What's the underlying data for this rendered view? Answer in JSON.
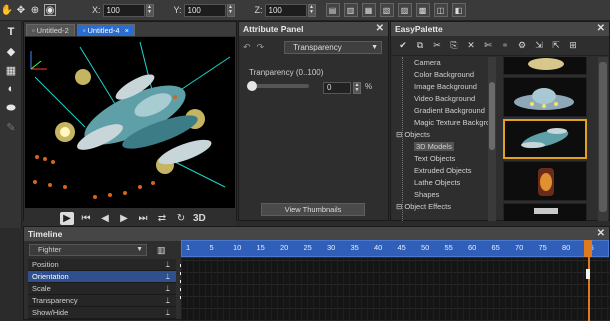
{
  "toolbar": {
    "x_label": "X:",
    "x_value": "100",
    "y_label": "Y:",
    "y_value": "100",
    "z_label": "Z:",
    "z_value": "100"
  },
  "viewer": {
    "tabs": [
      {
        "label": "Untitled-2"
      },
      {
        "label": "Untitled-4"
      }
    ],
    "mode_3d": "3D"
  },
  "attribute_panel": {
    "title": "Attribute Panel",
    "dropdown_value": "Transparency",
    "transparency_label": "Tranparency (0..100)",
    "transparency_value": "0",
    "transparency_unit": "%",
    "view_thumbnails": "View Thumbnails"
  },
  "palette": {
    "title": "EasyPalette",
    "tree": [
      {
        "label": "Camera",
        "level": 2
      },
      {
        "label": "Color Background",
        "level": 2
      },
      {
        "label": "Image Background",
        "level": 2
      },
      {
        "label": "Video Background",
        "level": 2
      },
      {
        "label": "Gradient Background",
        "level": 2
      },
      {
        "label": "Magic Texture Background",
        "level": 2
      },
      {
        "label": "Objects",
        "level": 1
      },
      {
        "label": "3D Models",
        "level": 2,
        "selected": true
      },
      {
        "label": "Text Objects",
        "level": 2
      },
      {
        "label": "Extruded Objects",
        "level": 2
      },
      {
        "label": "Lathe Objects",
        "level": 2
      },
      {
        "label": "Shapes",
        "level": 2
      },
      {
        "label": "Object Effects",
        "level": 1
      }
    ]
  },
  "timeline": {
    "title": "Timeline",
    "object_select": "Fighter",
    "tracks": [
      {
        "label": "Position"
      },
      {
        "label": "Orientation",
        "selected": true
      },
      {
        "label": "Scale"
      },
      {
        "label": "Transparency"
      },
      {
        "label": "Show/Hide"
      }
    ],
    "ruler_ticks": [
      "1",
      "5",
      "10",
      "15",
      "20",
      "25",
      "30",
      "35",
      "40",
      "45",
      "50",
      "55",
      "60",
      "65",
      "70",
      "75",
      "80",
      "85"
    ]
  },
  "colors": {
    "accent": "#2a6dd1",
    "ruler": "#2f5fb8",
    "playhead": "#e07a20",
    "selection": "#2f4f8f"
  }
}
